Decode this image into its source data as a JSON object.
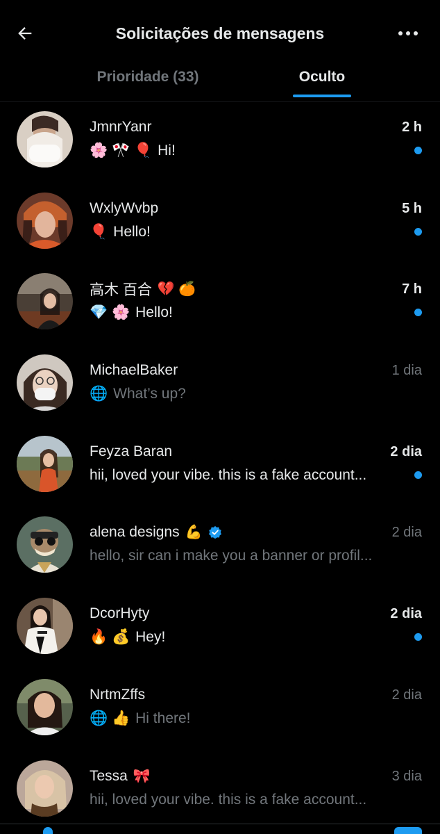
{
  "header": {
    "title": "Solicitações de mensagens",
    "back_icon": "arrow-left-icon",
    "more_icon": "more-horizontal-icon"
  },
  "tabs": [
    {
      "label": "Prioridade (33)",
      "active": false
    },
    {
      "label": "Oculto",
      "active": true
    }
  ],
  "colors": {
    "accent": "#1d9bf0",
    "background": "#000000",
    "text_primary": "#e7e9ea",
    "text_secondary": "#71767b"
  },
  "messages": [
    {
      "name": "JmnrYanr",
      "name_emoji": "",
      "verified": false,
      "time": "2 h",
      "unread": true,
      "preview_emoji": "🌸 🎌 🎈",
      "preview": "Hi!"
    },
    {
      "name": "WxlyWvbp",
      "name_emoji": "",
      "verified": false,
      "time": "5 h",
      "unread": true,
      "preview_emoji": "🎈",
      "preview": "Hello!"
    },
    {
      "name": "高木 百合",
      "name_emoji": "💔 🍊",
      "verified": false,
      "time": "7 h",
      "unread": true,
      "preview_emoji": "💎 🌸",
      "preview": "Hello!"
    },
    {
      "name": "MichaelBaker",
      "name_emoji": "",
      "verified": false,
      "time": "1 dia",
      "unread": false,
      "preview_emoji": "🌐",
      "preview": "What’s up?"
    },
    {
      "name": "Feyza Baran",
      "name_emoji": "",
      "verified": false,
      "time": "2 dia",
      "unread": true,
      "preview_emoji": "",
      "preview": "hii, loved your vibe. this is a fake account..."
    },
    {
      "name": "alena designs",
      "name_emoji": "💪",
      "verified": true,
      "time": "2 dia",
      "unread": false,
      "preview_emoji": "",
      "preview": "hello, sir can i make you a banner or profil..."
    },
    {
      "name": "DcorHyty",
      "name_emoji": "",
      "verified": false,
      "time": "2 dia",
      "unread": true,
      "preview_emoji": "🔥 💰",
      "preview": "Hey!"
    },
    {
      "name": "NrtmZffs",
      "name_emoji": "",
      "verified": false,
      "time": "2 dia",
      "unread": false,
      "preview_emoji": "🌐 👍",
      "preview": "Hi there!"
    },
    {
      "name": "Tessa",
      "name_emoji": "🎀",
      "verified": false,
      "time": "3 dia",
      "unread": false,
      "preview_emoji": "",
      "preview": "hii, loved your vibe. this is a fake account..."
    }
  ]
}
